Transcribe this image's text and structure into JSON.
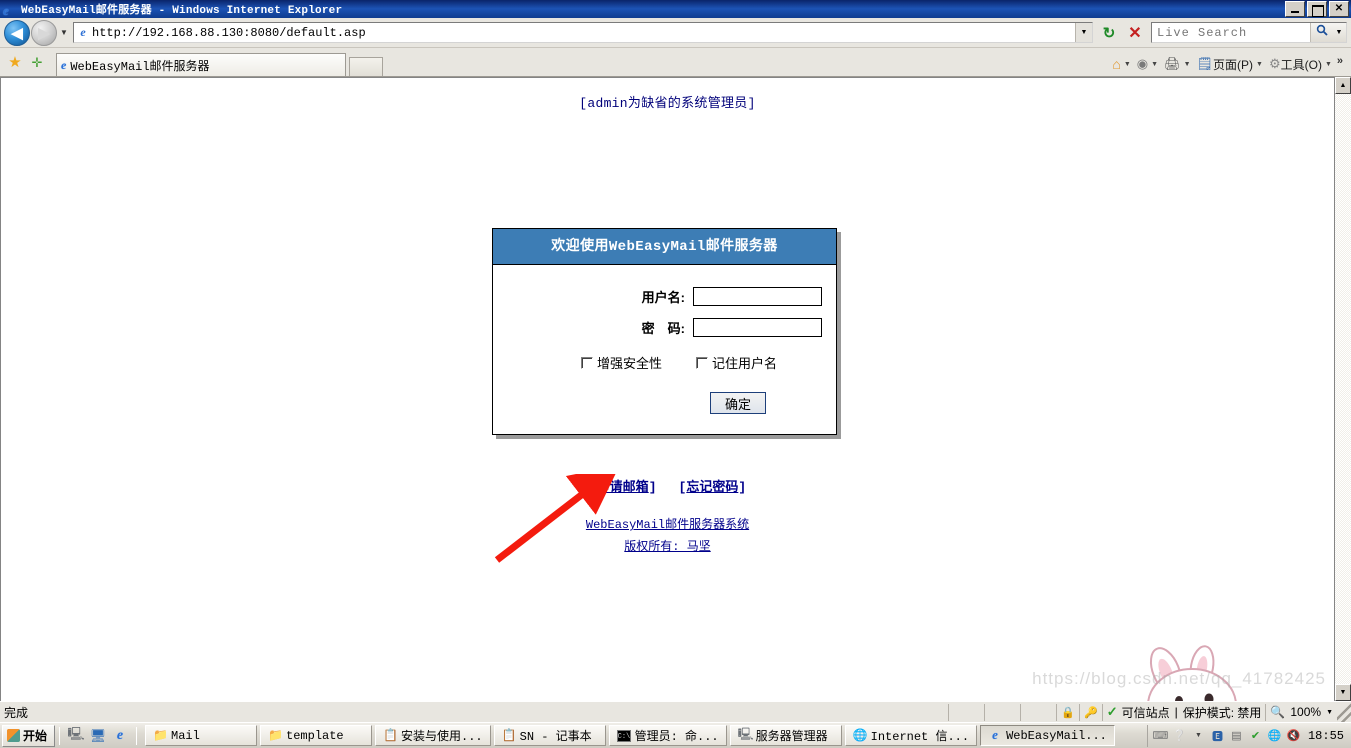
{
  "window": {
    "title": "WebEasyMail邮件服务器 - Windows Internet Explorer",
    "minimize_label": "_",
    "restore_label": "❐",
    "close_label": "✕"
  },
  "navbar": {
    "back_label": "◀",
    "forward_label": "▶",
    "history_label": "▼",
    "url": "http://192.168.88.130:8080/default.asp",
    "url_dropdown_label": "▼",
    "refresh_label": "↻",
    "stop_label": "✕",
    "search_placeholder": "Live Search",
    "search_value": "",
    "search_go_label": "🔍",
    "search_dropdown_label": "▼"
  },
  "tabbar": {
    "favorites_label": "★",
    "add_favorite_label": "✛",
    "tab_title": "WebEasyMail邮件服务器",
    "new_tab_label": ""
  },
  "commandbar": {
    "home_label": "",
    "feeds_label": "",
    "print_label": "",
    "page_label": "页面(P)",
    "tools_label": "工具(O)",
    "overflow_label": "»",
    "arrow_label": "▼"
  },
  "page": {
    "admin_note": "[admin为缺省的系统管理员]",
    "login": {
      "header": "欢迎使用WebEasyMail邮件服务器",
      "username_label": "用户名:",
      "username_value": "",
      "password_label": "密　码:",
      "password_value": "",
      "checkbox_security": "增强安全性",
      "checkbox_remember": "记住用户名",
      "submit_label": "确定"
    },
    "links": {
      "apply_mailbox": "申请邮箱",
      "forgot_password": "忘记密码",
      "bracket_open": "[",
      "bracket_close": "]"
    },
    "footer": {
      "system_name": "WebEasyMail邮件服务器系统",
      "copyright": "版权所有: 马坚"
    },
    "watermark": "https://blog.csdn.net/qq_41782425",
    "colors": {
      "header_blue": "#3d7db5",
      "link_navy": "#00008b",
      "note_navy": "#00007a",
      "arrow_red": "#f41b0e"
    }
  },
  "scrollbar": {
    "up_label": "▲",
    "down_label": "▼"
  },
  "statusbar": {
    "status_text": "完成",
    "zone_text": "可信站点",
    "separator": "|",
    "protected_mode": "保护模式: 禁用",
    "zoom_level": "100%",
    "zoom_dropdown_label": "▼"
  },
  "taskbar": {
    "start_label": "开始",
    "quick_launch": [
      "server-icon",
      "show-desktop-icon",
      "internet-explorer-icon"
    ],
    "items": [
      {
        "label": "Mail",
        "icon": "folder-icon",
        "active": false
      },
      {
        "label": "template",
        "icon": "folder-icon",
        "active": false
      },
      {
        "label": "安装与使用...",
        "icon": "notepad-icon",
        "active": false
      },
      {
        "label": "SN - 记事本",
        "icon": "notepad-icon",
        "active": false
      },
      {
        "label": "管理员: 命...",
        "icon": "command-prompt-icon",
        "active": false
      },
      {
        "label": "服务器管理器",
        "icon": "server-manager-icon",
        "active": false
      },
      {
        "label": "Internet 信...",
        "icon": "iis-icon",
        "active": false
      },
      {
        "label": "WebEasyMail...",
        "icon": "internet-explorer-icon",
        "active": true
      }
    ],
    "clock": "18:55"
  }
}
